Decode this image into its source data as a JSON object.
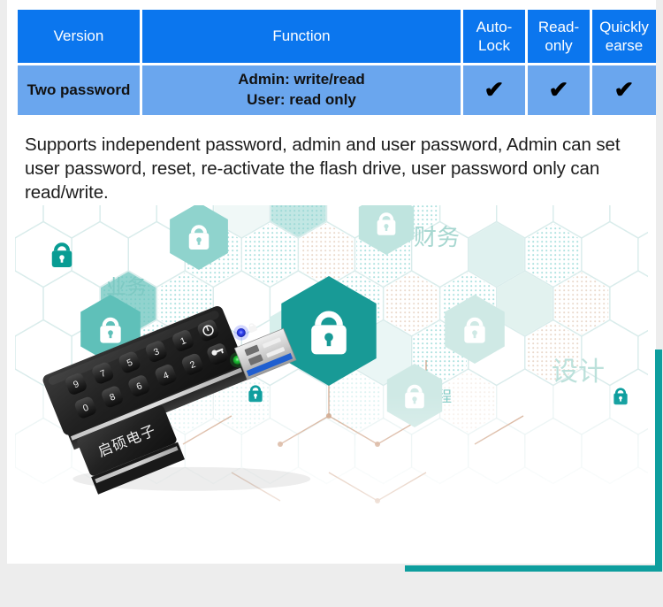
{
  "table": {
    "headers": [
      "Version",
      "Function",
      "Auto-Lock",
      "Read-only",
      "Quickly earse"
    ],
    "rows": [
      {
        "version": "Two password",
        "function_line1": "Admin: write/read",
        "function_line2": "User: read only",
        "auto_lock": "✔",
        "read_only": "✔",
        "quickly_earse": "✔"
      }
    ],
    "header_bg": "#0b76ee",
    "row_bg": "#6aa6ee",
    "header_text_color": "#ffffff",
    "row_text_color": "#111111"
  },
  "description": {
    "text": "Supports independent password, admin and user password, Admin can set user password, reset, re-activate the flash drive, user password only can read/write."
  },
  "illustration": {
    "alt": "Encrypted keypad USB flash drive on a teal hexagon security background",
    "accent_color": "#0e9e9e",
    "hex_labels": [
      {
        "text": "业务",
        "meaning": "business"
      },
      {
        "text": "财务",
        "meaning": "finance"
      },
      {
        "text": "工程",
        "meaning": "engineering"
      },
      {
        "text": "设计",
        "meaning": "design"
      }
    ],
    "usb": {
      "cap_label": "启硕电子",
      "keypad_keys": [
        "0",
        "1",
        "2",
        "3",
        "4",
        "5",
        "6",
        "7",
        "8",
        "9"
      ],
      "function_keys": [
        "power-key",
        "unlock-key"
      ],
      "led_indicators": [
        {
          "name": "blue-led",
          "color": "#2b3ff0"
        },
        {
          "name": "green-led",
          "color": "#24c436"
        }
      ],
      "connector": "USB 3.0"
    }
  }
}
